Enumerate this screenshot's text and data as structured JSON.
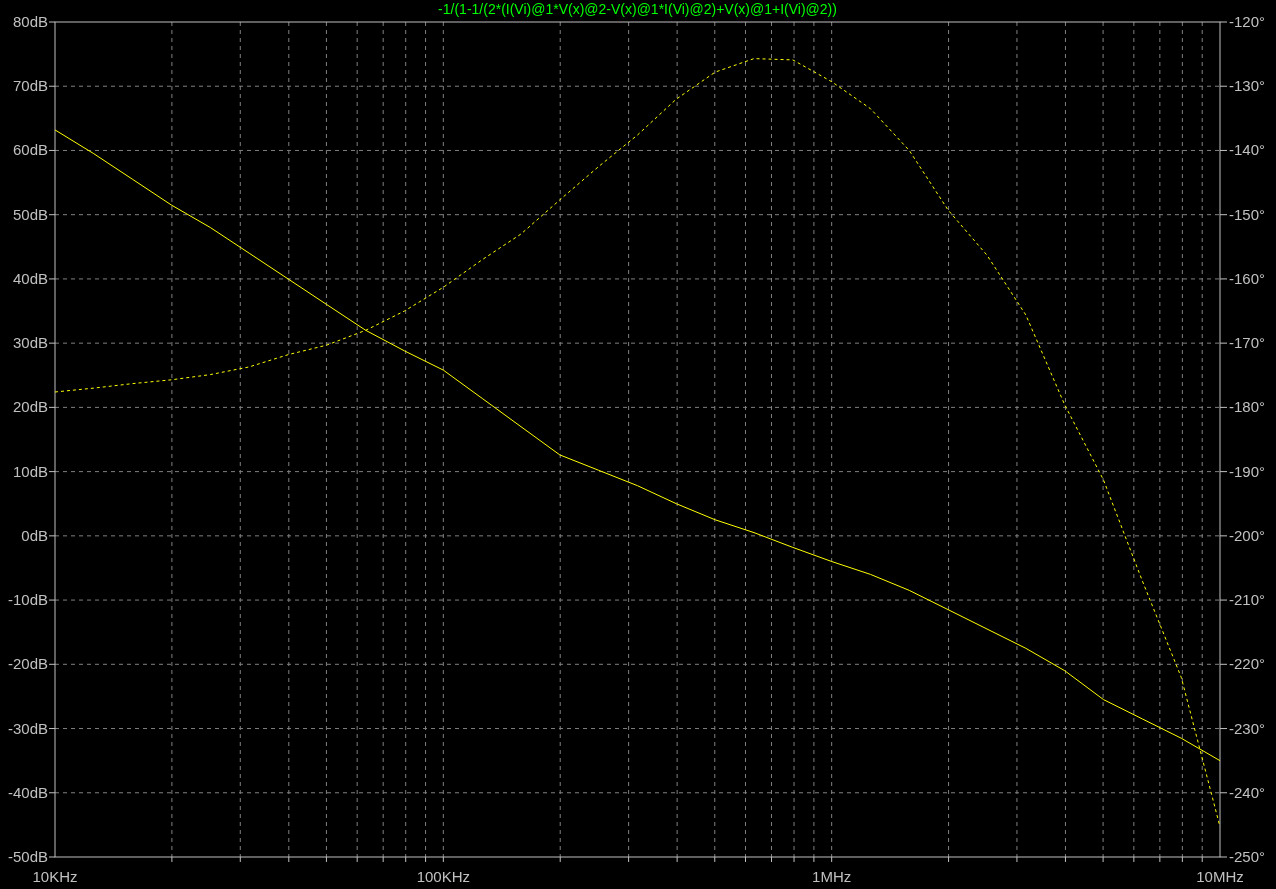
{
  "plot": {
    "chart_data": {
      "type": "line",
      "grid": true,
      "title": "-1/(1-1/(2*(I(Vi)@1*V(x)@2-V(x)@1*I(Vi)@2)+V(x)@1+I(Vi)@2))",
      "categories": [
        "10KHz",
        null,
        null,
        null,
        null,
        null,
        null,
        null,
        null,
        null,
        "100KHz",
        null,
        null,
        null,
        null,
        null,
        null,
        null,
        null,
        null,
        "1MHz",
        null,
        null,
        null,
        null,
        null,
        null,
        null,
        null,
        null,
        "10MHz"
      ],
      "ylim": [
        -50,
        80
      ],
      "yticks": [
        {
          "value": 80,
          "label": "80dB"
        },
        {
          "value": 70,
          "label": "70dB"
        },
        {
          "value": 60,
          "label": "60dB"
        },
        {
          "value": 50,
          "label": "50dB"
        },
        {
          "value": 40,
          "label": "40dB"
        },
        {
          "value": 30,
          "label": "30dB"
        },
        {
          "value": 20,
          "label": "20dB"
        },
        {
          "value": 10,
          "label": "10dB"
        },
        {
          "value": 0,
          "label": "0dB"
        },
        {
          "value": -10,
          "label": "-10dB"
        },
        {
          "value": -20,
          "label": "-20dB"
        },
        {
          "value": -30,
          "label": "-30dB"
        },
        {
          "value": -40,
          "label": "-40dB"
        },
        {
          "value": -50,
          "label": "-50dB"
        }
      ],
      "y2lim": [
        -250,
        -120
      ],
      "y2ticks": [
        {
          "value": -120,
          "label": "-120°"
        },
        {
          "value": -130,
          "label": "-130°"
        },
        {
          "value": -140,
          "label": "-140°"
        },
        {
          "value": -150,
          "label": "-150°"
        },
        {
          "value": -160,
          "label": "-160°"
        },
        {
          "value": -170,
          "label": "-170°"
        },
        {
          "value": -180,
          "label": "-180°"
        },
        {
          "value": -190,
          "label": "-190°"
        },
        {
          "value": -200,
          "label": "-200°"
        },
        {
          "value": -210,
          "label": "-210°"
        },
        {
          "value": -220,
          "label": "-220°"
        },
        {
          "value": -230,
          "label": "-230°"
        },
        {
          "value": -240,
          "label": "-240°"
        },
        {
          "value": -250,
          "label": "-250°"
        }
      ],
      "series": [
        {
          "color": "#ffff00",
          "line_style": "solid",
          "values": [
            63.2,
            59.5,
            55.5,
            51.5,
            48,
            44,
            40,
            36,
            32,
            28.8,
            25.8,
            21.4,
            17,
            12.6,
            10.2,
            7.8,
            5,
            2.5,
            0.5,
            -1.8,
            -4,
            -6,
            -8.5,
            -11.5,
            -14.5,
            -17.5,
            -21,
            -25.5,
            -28.5,
            -31.5,
            -35
          ]
        },
        {
          "color": "#ffff00",
          "axis": "y2",
          "line_style": "dashed",
          "values": [
            -177.6,
            -177,
            -176.3,
            -175.7,
            -174.9,
            -173.7,
            -171.8,
            -170.3,
            -168,
            -165,
            -161.3,
            -157,
            -153,
            -147.7,
            -142.5,
            -137.6,
            -132,
            -127.8,
            -125.7,
            -125.9,
            -129.3,
            -133.5,
            -140,
            -149.3,
            -156.3,
            -165.6,
            -179.6,
            -191.3,
            -207,
            -222,
            -245.3
          ]
        }
      ]
    }
  }
}
